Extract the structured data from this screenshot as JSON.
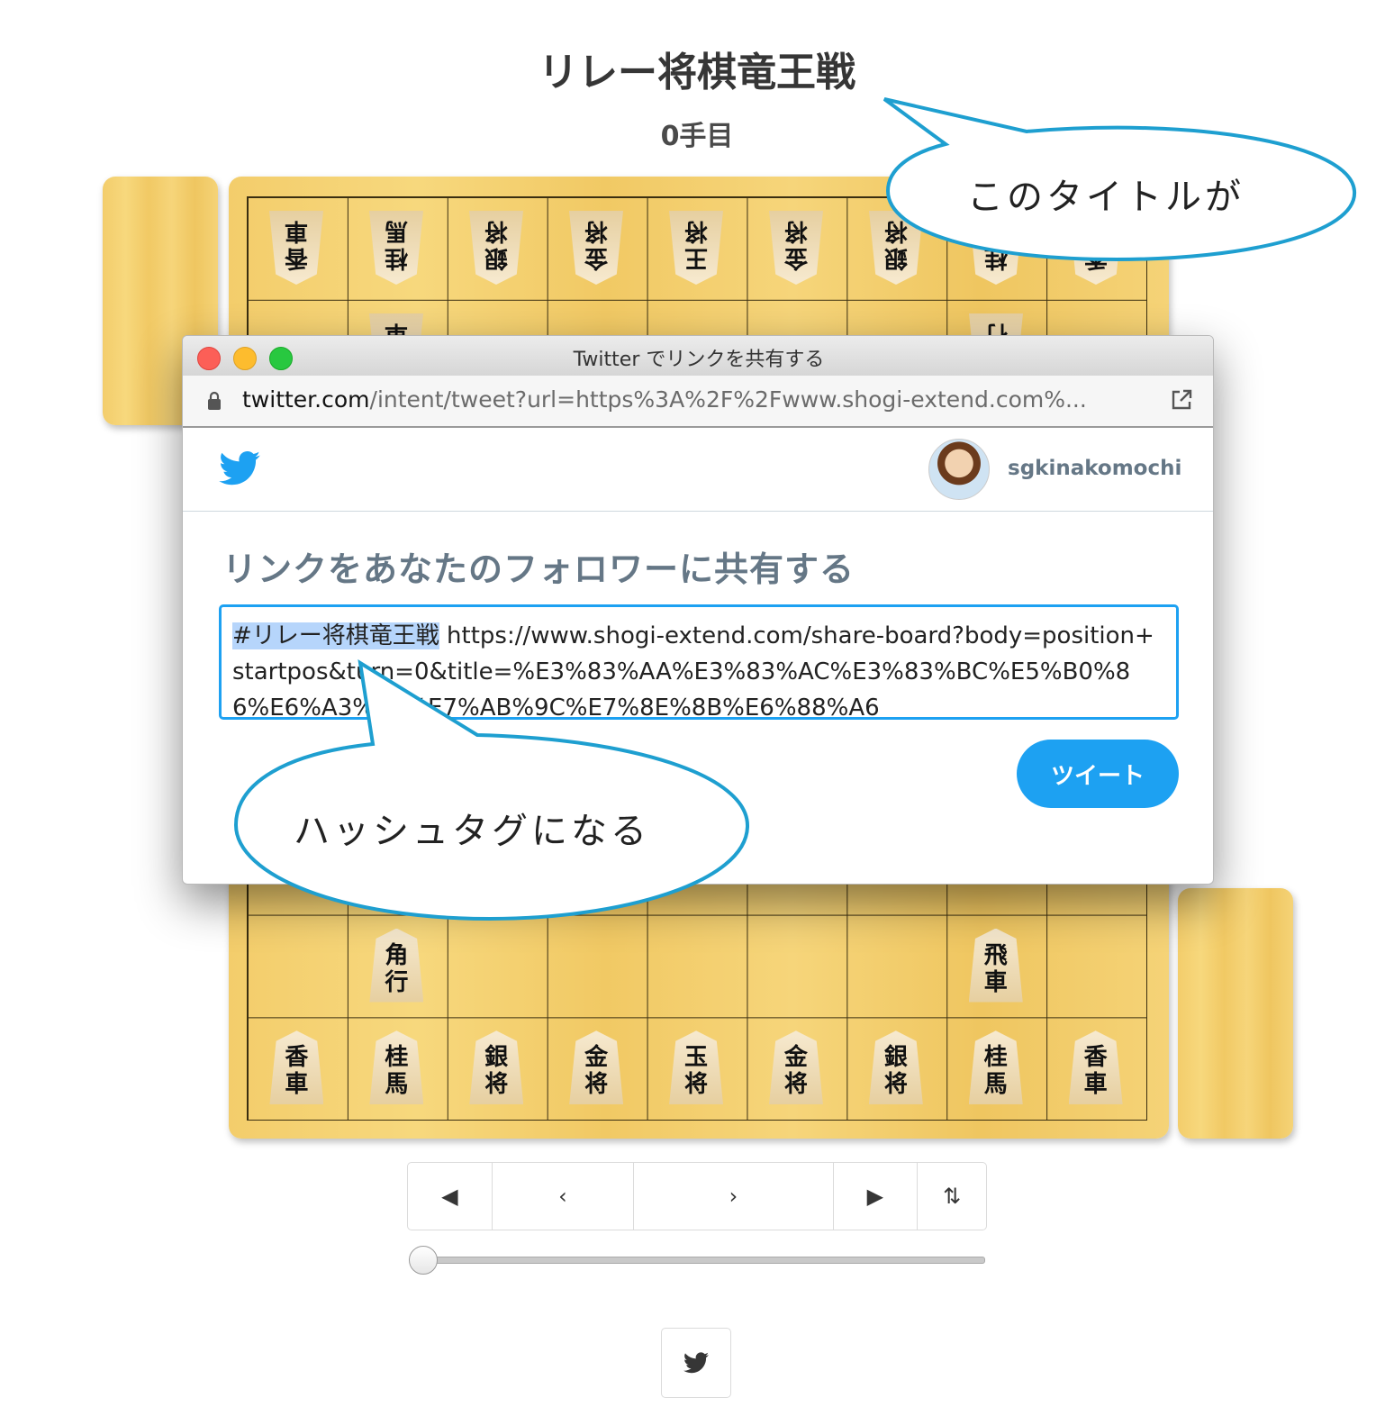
{
  "page": {
    "title": "リレー将棋竜王戦",
    "turn": "0手目"
  },
  "board": {
    "gote_back_row": [
      [
        "香",
        "車"
      ],
      [
        "桂",
        "馬"
      ],
      [
        "銀",
        "将"
      ],
      [
        "金",
        "将"
      ],
      [
        "王",
        "将"
      ],
      [
        "金",
        "将"
      ],
      [
        "銀",
        "将"
      ],
      [
        "桂",
        "馬"
      ],
      [
        "香",
        "車"
      ]
    ],
    "gote_second_row": [
      [
        "飛",
        "車"
      ],
      [
        "角",
        "行"
      ]
    ],
    "sente_second_row": [
      [
        "角",
        "行"
      ],
      [
        "飛",
        "車"
      ]
    ],
    "sente_back_row": [
      [
        "香",
        "車"
      ],
      [
        "桂",
        "馬"
      ],
      [
        "銀",
        "将"
      ],
      [
        "金",
        "将"
      ],
      [
        "玉",
        "将"
      ],
      [
        "金",
        "将"
      ],
      [
        "銀",
        "将"
      ],
      [
        "桂",
        "馬"
      ],
      [
        "香",
        "車"
      ]
    ]
  },
  "nav": {
    "first": "◀",
    "prev": "‹",
    "next": "›",
    "last": "▶",
    "flip": "⇅"
  },
  "slider": {
    "value": 0
  },
  "popup": {
    "window_title": "Twitter でリンクを共有する",
    "url_host": "twitter.com",
    "url_path": "/intent/tweet?url=https%3A%2F%2Fwww.shogi-extend.com%...",
    "username": "sgkinakomochi",
    "heading": "リンクをあなたのフォロワーに共有する",
    "hashtag": "#リレー将棋竜王戦",
    "tweet_text": " https://www.shogi-extend.com/share-board?body=position+startpos&turn=0&title=%E3%83%AA%E3%83%AC%E3%83%BC%E5%B0%86%E6%A3%8B%E7%AB%9C%E7%8E%8B%E6%88%A6",
    "tweet_button": "ツイート"
  },
  "callouts": {
    "title_callout": "このタイトルが",
    "hashtag_callout": "ハッシュタグになる"
  },
  "colors": {
    "accent": "#1da1f2",
    "callout_stroke": "#1e9fd0",
    "board_wood": "#f3cd6b"
  },
  "icons": {
    "twitter": "twitter-bird-icon",
    "lock": "lock-icon",
    "external": "external-link-icon"
  }
}
